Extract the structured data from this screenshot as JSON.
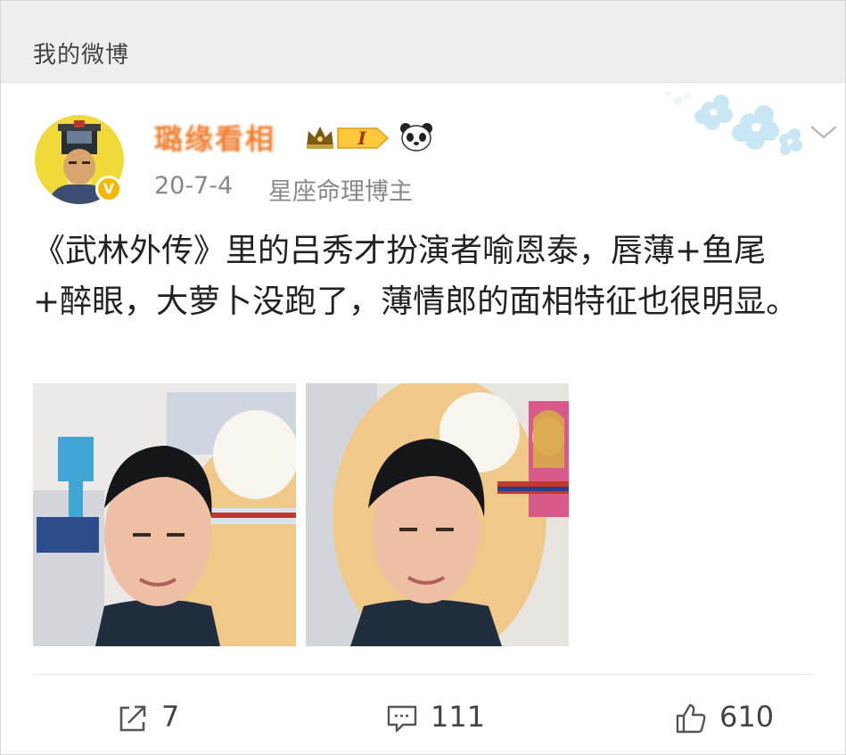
{
  "header": {
    "title": "我的微博"
  },
  "post": {
    "username": "璐缘看相",
    "level_badge": "I",
    "time": "20-7-4",
    "source": "星座命理博主",
    "verified_badge_color": "#f7b600",
    "username_color": "#f07d2c",
    "text": "《武林外传》里的吕秀才扮演者喻恩泰，唇薄+鱼尾+醉眼，大萝卜没跑了，薄情郎的面相特征也很明显。"
  },
  "actions": {
    "repost_count": "7",
    "comment_count": "111",
    "like_count": "610"
  },
  "icons": {
    "avatar": "avatar-portrait-icon",
    "verify": "verified-badge-icon",
    "crown": "crown-icon",
    "panda": "panda-icon",
    "chevron": "chevron-down-icon",
    "repost": "repost-icon",
    "comment": "comment-icon",
    "like": "thumbs-up-icon"
  }
}
